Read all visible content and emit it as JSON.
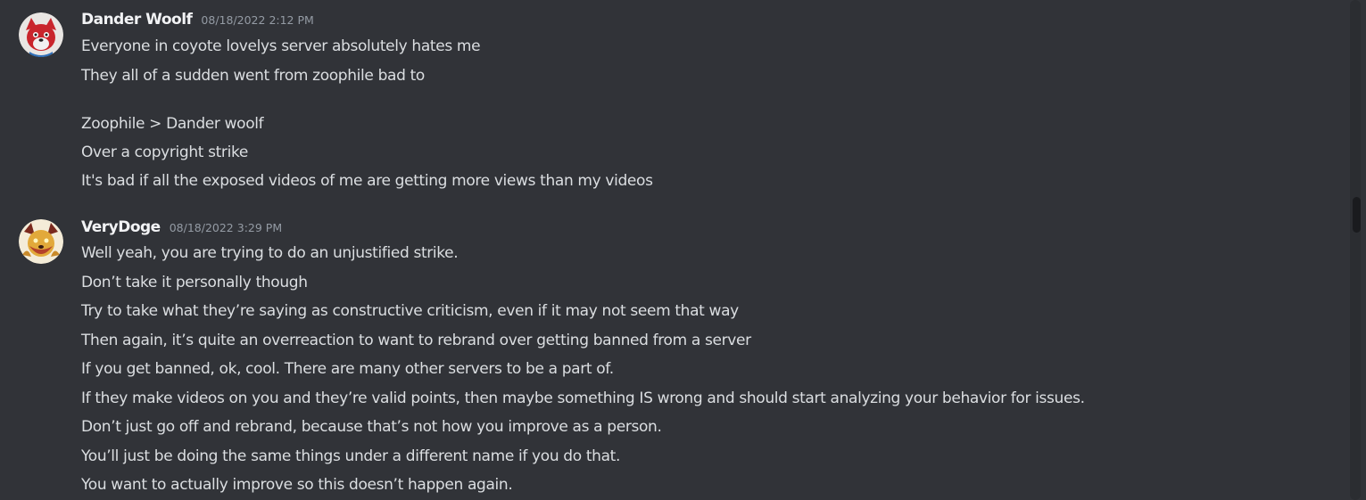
{
  "messages": [
    {
      "author": "Dander Woolf",
      "timestamp": "08/18/2022 2:12 PM",
      "lines": [
        "Everyone in coyote lovelys server absolutely hates me",
        "They all of a sudden went from zoophile bad to",
        "Zoophile > Dander woolf",
        "Over a copyright strike",
        "It's bad if all the exposed videos of me are getting more views than my videos"
      ]
    },
    {
      "author": "VeryDoge",
      "timestamp": "08/18/2022 3:29 PM",
      "lines": [
        "Well yeah, you are trying to do an unjustified strike.",
        "Don’t take it personally though",
        "Try to take what they’re saying as constructive criticism, even if it may not seem that way",
        "Then again, it’s quite an overreaction to want to rebrand over getting banned from a server",
        "If you get banned, ok, cool. There are many other servers to be a part of.",
        "If they make videos on you and they’re valid points, then maybe something IS wrong and should start analyzing your behavior for issues.",
        "Don’t just go off and rebrand, because that’s not how you improve as a person.",
        "You’ll just be doing the same things under a different name if you do that.",
        "You want to actually improve so this doesn’t happen again."
      ]
    }
  ]
}
